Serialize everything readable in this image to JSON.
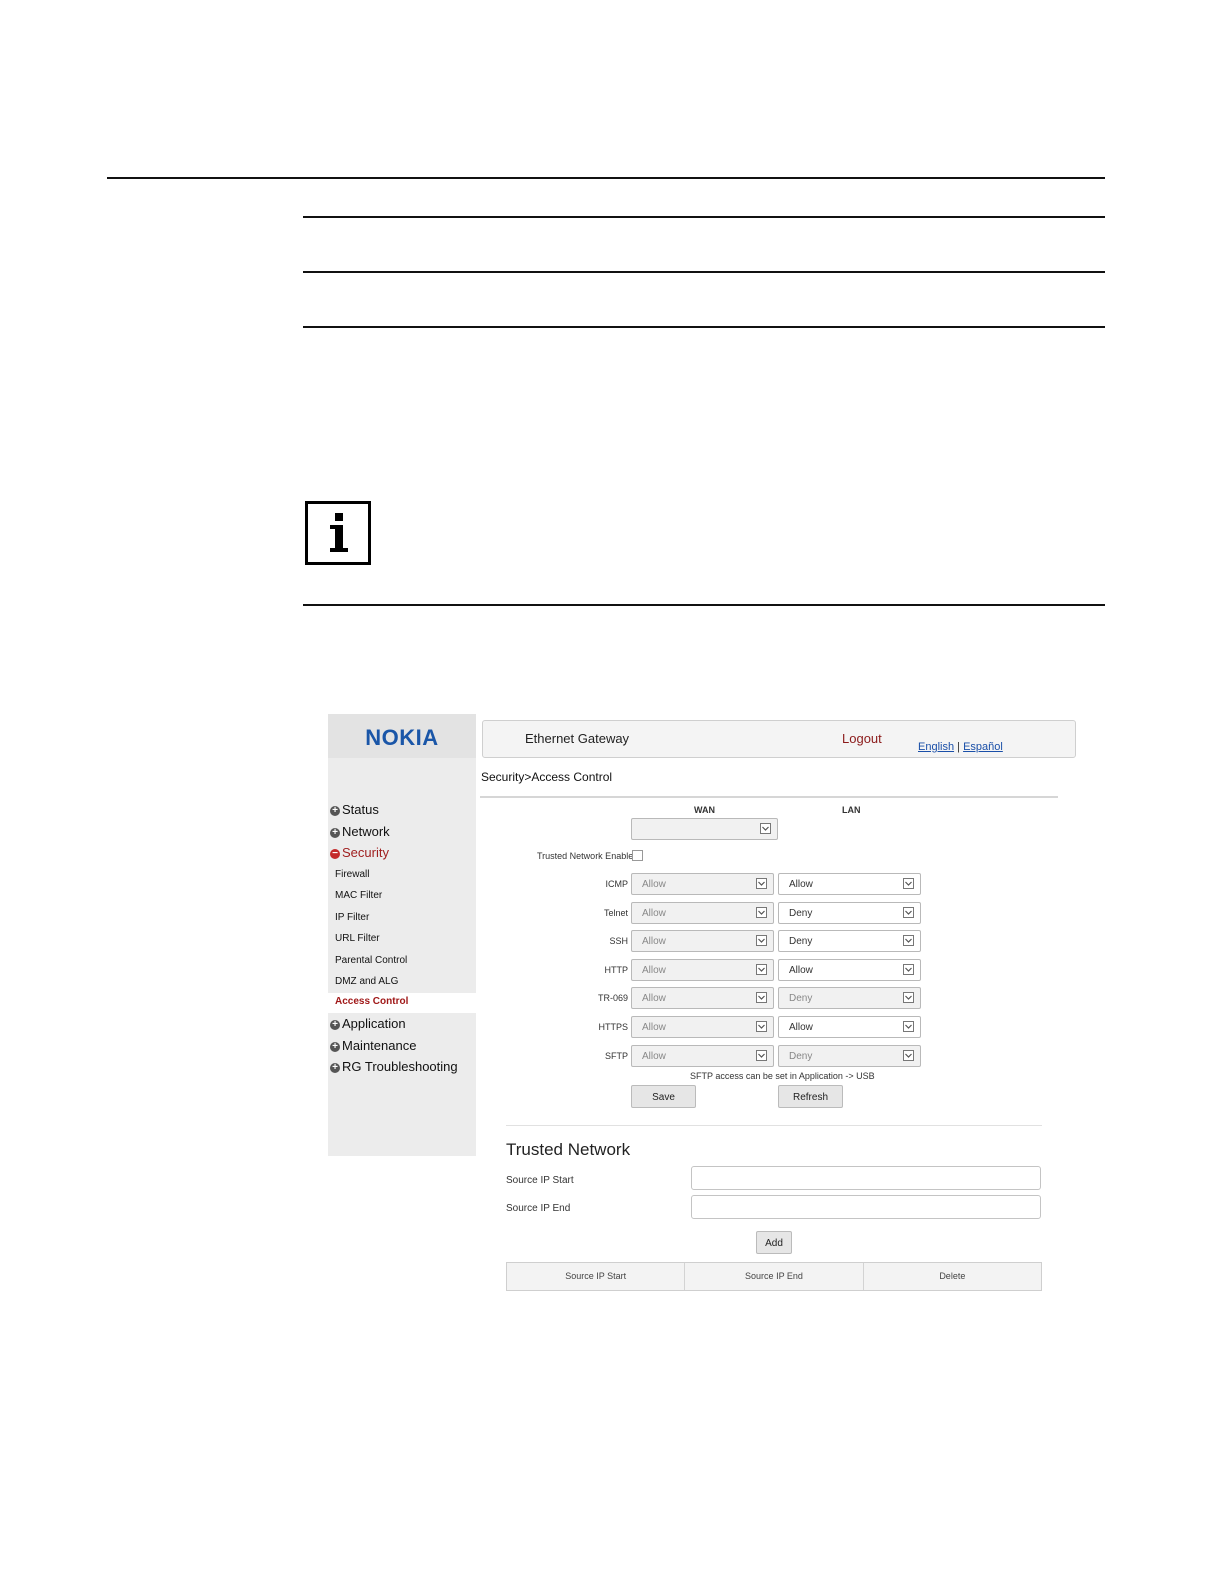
{
  "app": {
    "logo": "NOKIA",
    "title": "Ethernet Gateway",
    "logout": "Logout",
    "lang_english": "English",
    "lang_separator": "|",
    "lang_espanol": "Español",
    "breadcrumb": "Security>Access Control"
  },
  "menu": {
    "status": "Status",
    "network": "Network",
    "security": "Security",
    "security_sub": [
      "Firewall",
      "MAC Filter",
      "IP Filter",
      "URL Filter",
      "Parental Control",
      "DMZ and ALG"
    ],
    "access_control": "Access Control",
    "application": "Application",
    "maintenance": "Maintenance",
    "rg_troubleshooting": "RG Troubleshooting"
  },
  "access": {
    "wan_header": "WAN",
    "lan_header": "LAN",
    "trusted_enable_label": "Trusted Network Enable",
    "trusted_enable_checked": false,
    "rows": [
      {
        "service": "ICMP",
        "wan": "Allow",
        "lan": "Allow",
        "lan_enabled": true
      },
      {
        "service": "Telnet",
        "wan": "Allow",
        "lan": "Deny",
        "lan_enabled": true
      },
      {
        "service": "SSH",
        "wan": "Allow",
        "lan": "Deny",
        "lan_enabled": true
      },
      {
        "service": "HTTP",
        "wan": "Allow",
        "lan": "Allow",
        "lan_enabled": true
      },
      {
        "service": "TR-069",
        "wan": "Allow",
        "lan": "Deny",
        "lan_enabled": false
      },
      {
        "service": "HTTPS",
        "wan": "Allow",
        "lan": "Allow",
        "lan_enabled": true
      },
      {
        "service": "SFTP",
        "wan": "Allow",
        "lan": "Deny",
        "lan_enabled": false
      }
    ],
    "sftp_note": "SFTP access can be set in Application -> USB",
    "save": "Save",
    "refresh": "Refresh"
  },
  "trusted": {
    "title": "Trusted Network",
    "start_label": "Source IP Start",
    "end_label": "Source IP End",
    "start_value": "",
    "end_value": "",
    "add": "Add",
    "columns": [
      "Source IP Start",
      "Source IP End",
      "Delete"
    ]
  },
  "icons": {
    "info": "info-icon",
    "expand": "plus-circle-icon",
    "collapse": "minus-circle-icon",
    "dropdown": "chevron-down-icon"
  },
  "colors": {
    "brand": "#1a56a8",
    "active_menu": "#a02020"
  }
}
